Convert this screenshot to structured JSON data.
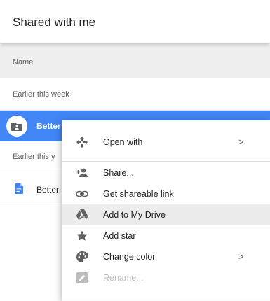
{
  "header": {
    "title": "Shared with me"
  },
  "columns": {
    "name": "Name"
  },
  "sections": [
    {
      "label": "Earlier this week"
    },
    {
      "label": "Earlier this y"
    }
  ],
  "rows": [
    {
      "name": "Better"
    },
    {
      "name": "Better"
    }
  ],
  "context_menu": {
    "items": [
      {
        "label": "Open with",
        "icon": "open-with-icon",
        "submenu": true
      },
      {
        "label": "Share...",
        "icon": "share-person-icon"
      },
      {
        "label": "Get shareable link",
        "icon": "link-icon"
      },
      {
        "label": "Add to My Drive",
        "icon": "add-to-drive-icon"
      },
      {
        "label": "Add star",
        "icon": "star-icon"
      },
      {
        "label": "Change color",
        "icon": "palette-icon",
        "submenu": true
      },
      {
        "label": "Rename...",
        "icon": "rename-icon",
        "disabled": true
      }
    ],
    "submenu_chevron": ">"
  },
  "colors": {
    "selection": "#4285f4",
    "doc_icon": "#4285f4",
    "menu_icon": "#616161",
    "disabled": "#bdbdbd"
  }
}
